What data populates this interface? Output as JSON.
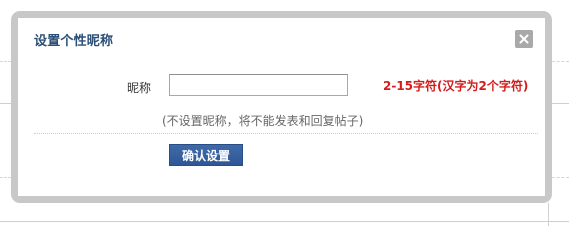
{
  "dialog": {
    "title": "设置个性昵称",
    "close_icon": "close-icon",
    "nickname_label": "昵称",
    "nickname_value": "",
    "nickname_placeholder": "",
    "hint": "2-15字符(汉字为2个字符)",
    "note": "(不设置昵称，将不能发表和回复帖子)",
    "confirm_label": "确认设置"
  },
  "colors": {
    "title": "#2b4f77",
    "hint": "#d51c1c",
    "button": "#3a63a3",
    "frame": "#c8c8c8"
  }
}
